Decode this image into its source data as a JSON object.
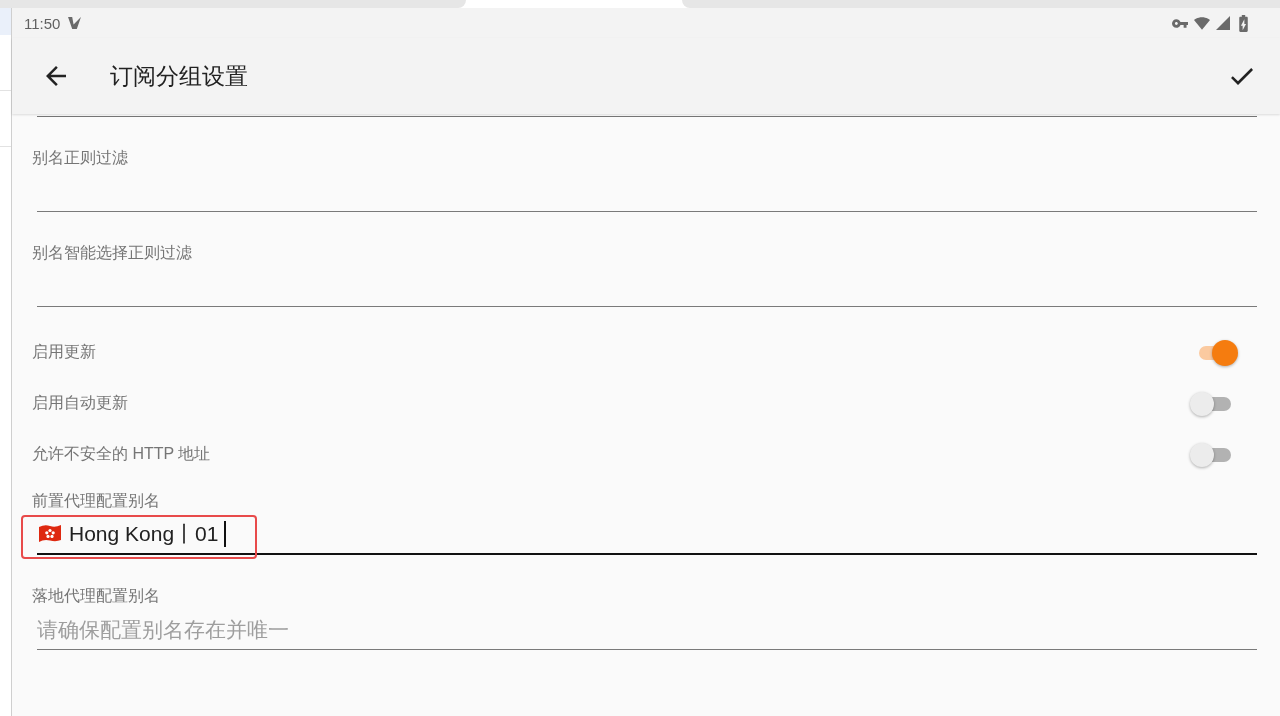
{
  "status_bar": {
    "time": "11:50"
  },
  "app_bar": {
    "title": "订阅分组设置"
  },
  "settings": [
    {
      "kind": "text_field",
      "label": "别名正则过滤",
      "focused": false,
      "highlighted": false
    },
    {
      "kind": "text_field",
      "label": "别名智能选择正则过滤",
      "focused": false,
      "highlighted": false
    },
    {
      "kind": "switch",
      "label": "启用更新",
      "on": true
    },
    {
      "kind": "switch",
      "label": "启用自动更新",
      "on": false
    },
    {
      "kind": "switch",
      "label": "允许不安全的 HTTP 地址",
      "on": false
    },
    {
      "kind": "text_field",
      "label": "前置代理配置别名",
      "value": "Hong Kong丨01",
      "focused": true,
      "highlighted": true
    },
    {
      "kind": "text_field",
      "label": "落地代理配置别名",
      "placeholder": "请确保配置别名存在并唯一",
      "focused": false,
      "highlighted": false
    }
  ]
}
